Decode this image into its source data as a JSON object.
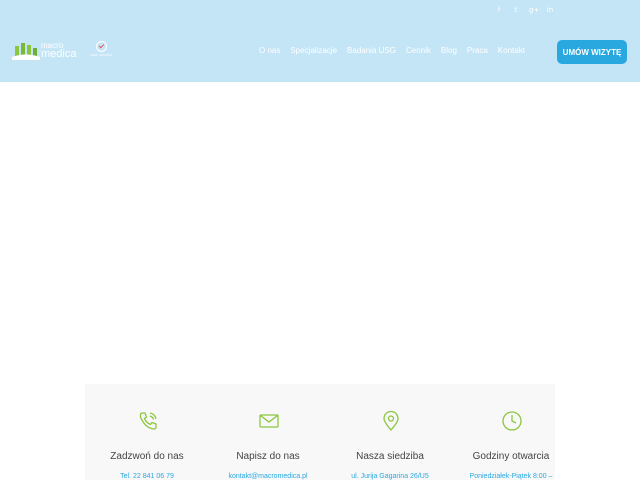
{
  "header": {
    "social": [
      "f",
      "t",
      "g+",
      "in"
    ],
    "logo": {
      "line1": "macro",
      "line2": "medica"
    },
    "badge": {
      "text": "ZNAK JAKOŚCI"
    },
    "nav": [
      "O nas",
      "Specjalizacje",
      "Badania USG",
      "Cennik",
      "Blog",
      "Praca",
      "Kontakt"
    ],
    "cta": "UMÓW WIZYTĘ"
  },
  "contact": {
    "accent": "#8cc63f",
    "items": [
      {
        "icon": "phone-icon",
        "title": "Zadzwoń do nas",
        "detail": "Tel. 22 841 06 79"
      },
      {
        "icon": "envelope-icon",
        "title": "Napisz do nas",
        "detail": "kontakt@macromedica.pl"
      },
      {
        "icon": "location-pin-icon",
        "title": "Nasza siedziba",
        "detail": "ul. Jurija Gagarina 26/U5"
      },
      {
        "icon": "clock-icon",
        "title": "Godziny otwarcia",
        "detail": "Poniedziałek-Piątek 8:00 –"
      }
    ]
  }
}
